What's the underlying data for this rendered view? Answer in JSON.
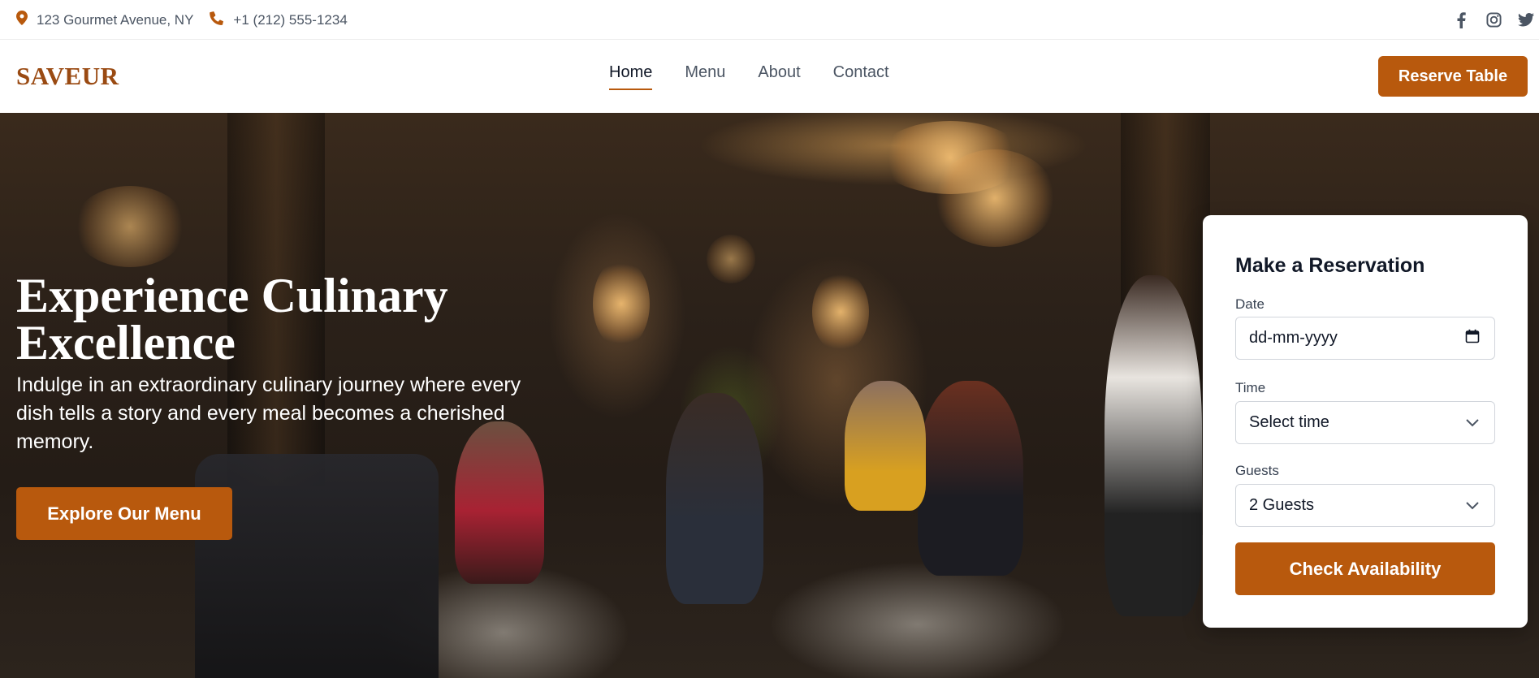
{
  "topbar": {
    "address": "123 Gourmet Avenue, NY",
    "phone": "+1 (212) 555-1234",
    "icons": [
      "map-pin-icon",
      "phone-icon",
      "facebook-icon",
      "instagram-icon",
      "twitter-icon"
    ]
  },
  "navbar": {
    "logo": "SAVEUR",
    "links": [
      {
        "label": "Home",
        "active": true
      },
      {
        "label": "Menu",
        "active": false
      },
      {
        "label": "About",
        "active": false
      },
      {
        "label": "Contact",
        "active": false
      }
    ],
    "reserve_label": "Reserve Table"
  },
  "hero": {
    "title": "Experience Culinary Excellence",
    "subtitle": "Indulge in an extraordinary culinary journey where every dish tells a story and every meal becomes a cherished memory.",
    "cta_label": "Explore Our Menu"
  },
  "reservation": {
    "title": "Make a Reservation",
    "date_label": "Date",
    "date_placeholder": "dd-mm-yyyy",
    "time_label": "Time",
    "time_value": "Select time",
    "guests_label": "Guests",
    "guests_value": "2 Guests",
    "submit_label": "Check Availability"
  },
  "colors": {
    "accent": "#b8590d",
    "logo": "#9a4a12",
    "text_muted": "#4b5563"
  }
}
